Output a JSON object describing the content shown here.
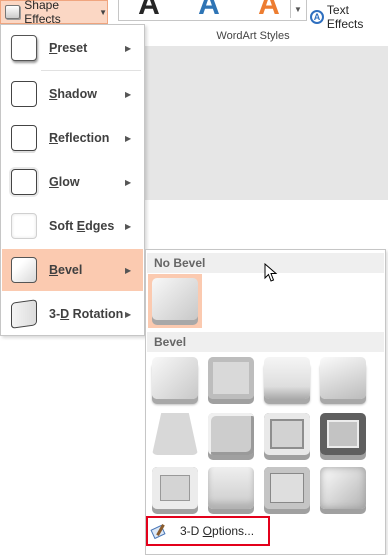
{
  "ribbon": {
    "shape_effects_label": "Shape Effects",
    "wordart_styles_label": "WordArt Styles",
    "text_effects_label": "Text Effects",
    "wordart_letters": [
      "A",
      "A",
      "A"
    ],
    "wordart_colors": [
      "#262626",
      "#2e75b6",
      "#ed7d31"
    ]
  },
  "menu": {
    "items": [
      {
        "label": "Preset",
        "underline": "P",
        "rest": "reset",
        "icon": "preset-icon"
      },
      {
        "label": "Shadow",
        "underline": "S",
        "rest": "hadow",
        "icon": "shadow-icon"
      },
      {
        "label": "Reflection",
        "underline": "R",
        "rest": "eflection",
        "icon": "reflection-icon"
      },
      {
        "label": "Glow",
        "underline": "G",
        "rest": "low",
        "icon": "glow-icon"
      },
      {
        "label": "Soft Edges",
        "pre": "Soft ",
        "underline": "E",
        "rest": "dges",
        "icon": "soft-edges-icon"
      },
      {
        "label": "Bevel",
        "underline": "B",
        "rest": "evel",
        "icon": "bevel-icon",
        "active": true
      },
      {
        "label": "3-D Rotation",
        "pre": "3-",
        "underline": "D",
        "rest": " Rotation",
        "icon": "3d-rotation-icon"
      }
    ]
  },
  "submenu": {
    "no_bevel_header": "No Bevel",
    "bevel_header": "Bevel",
    "options_label": "3-D Options...",
    "options_underline": "O",
    "bevel_presets": [
      "Circle",
      "Relaxed Inset",
      "Cross",
      "Cool Slant",
      "Angle",
      "Soft Round",
      "Convex",
      "Slope",
      "Divot",
      "Riblet",
      "Hard Edge",
      "Art Deco"
    ]
  },
  "colors": {
    "highlight": "#fbcab0",
    "options_outline": "#e3001b"
  }
}
